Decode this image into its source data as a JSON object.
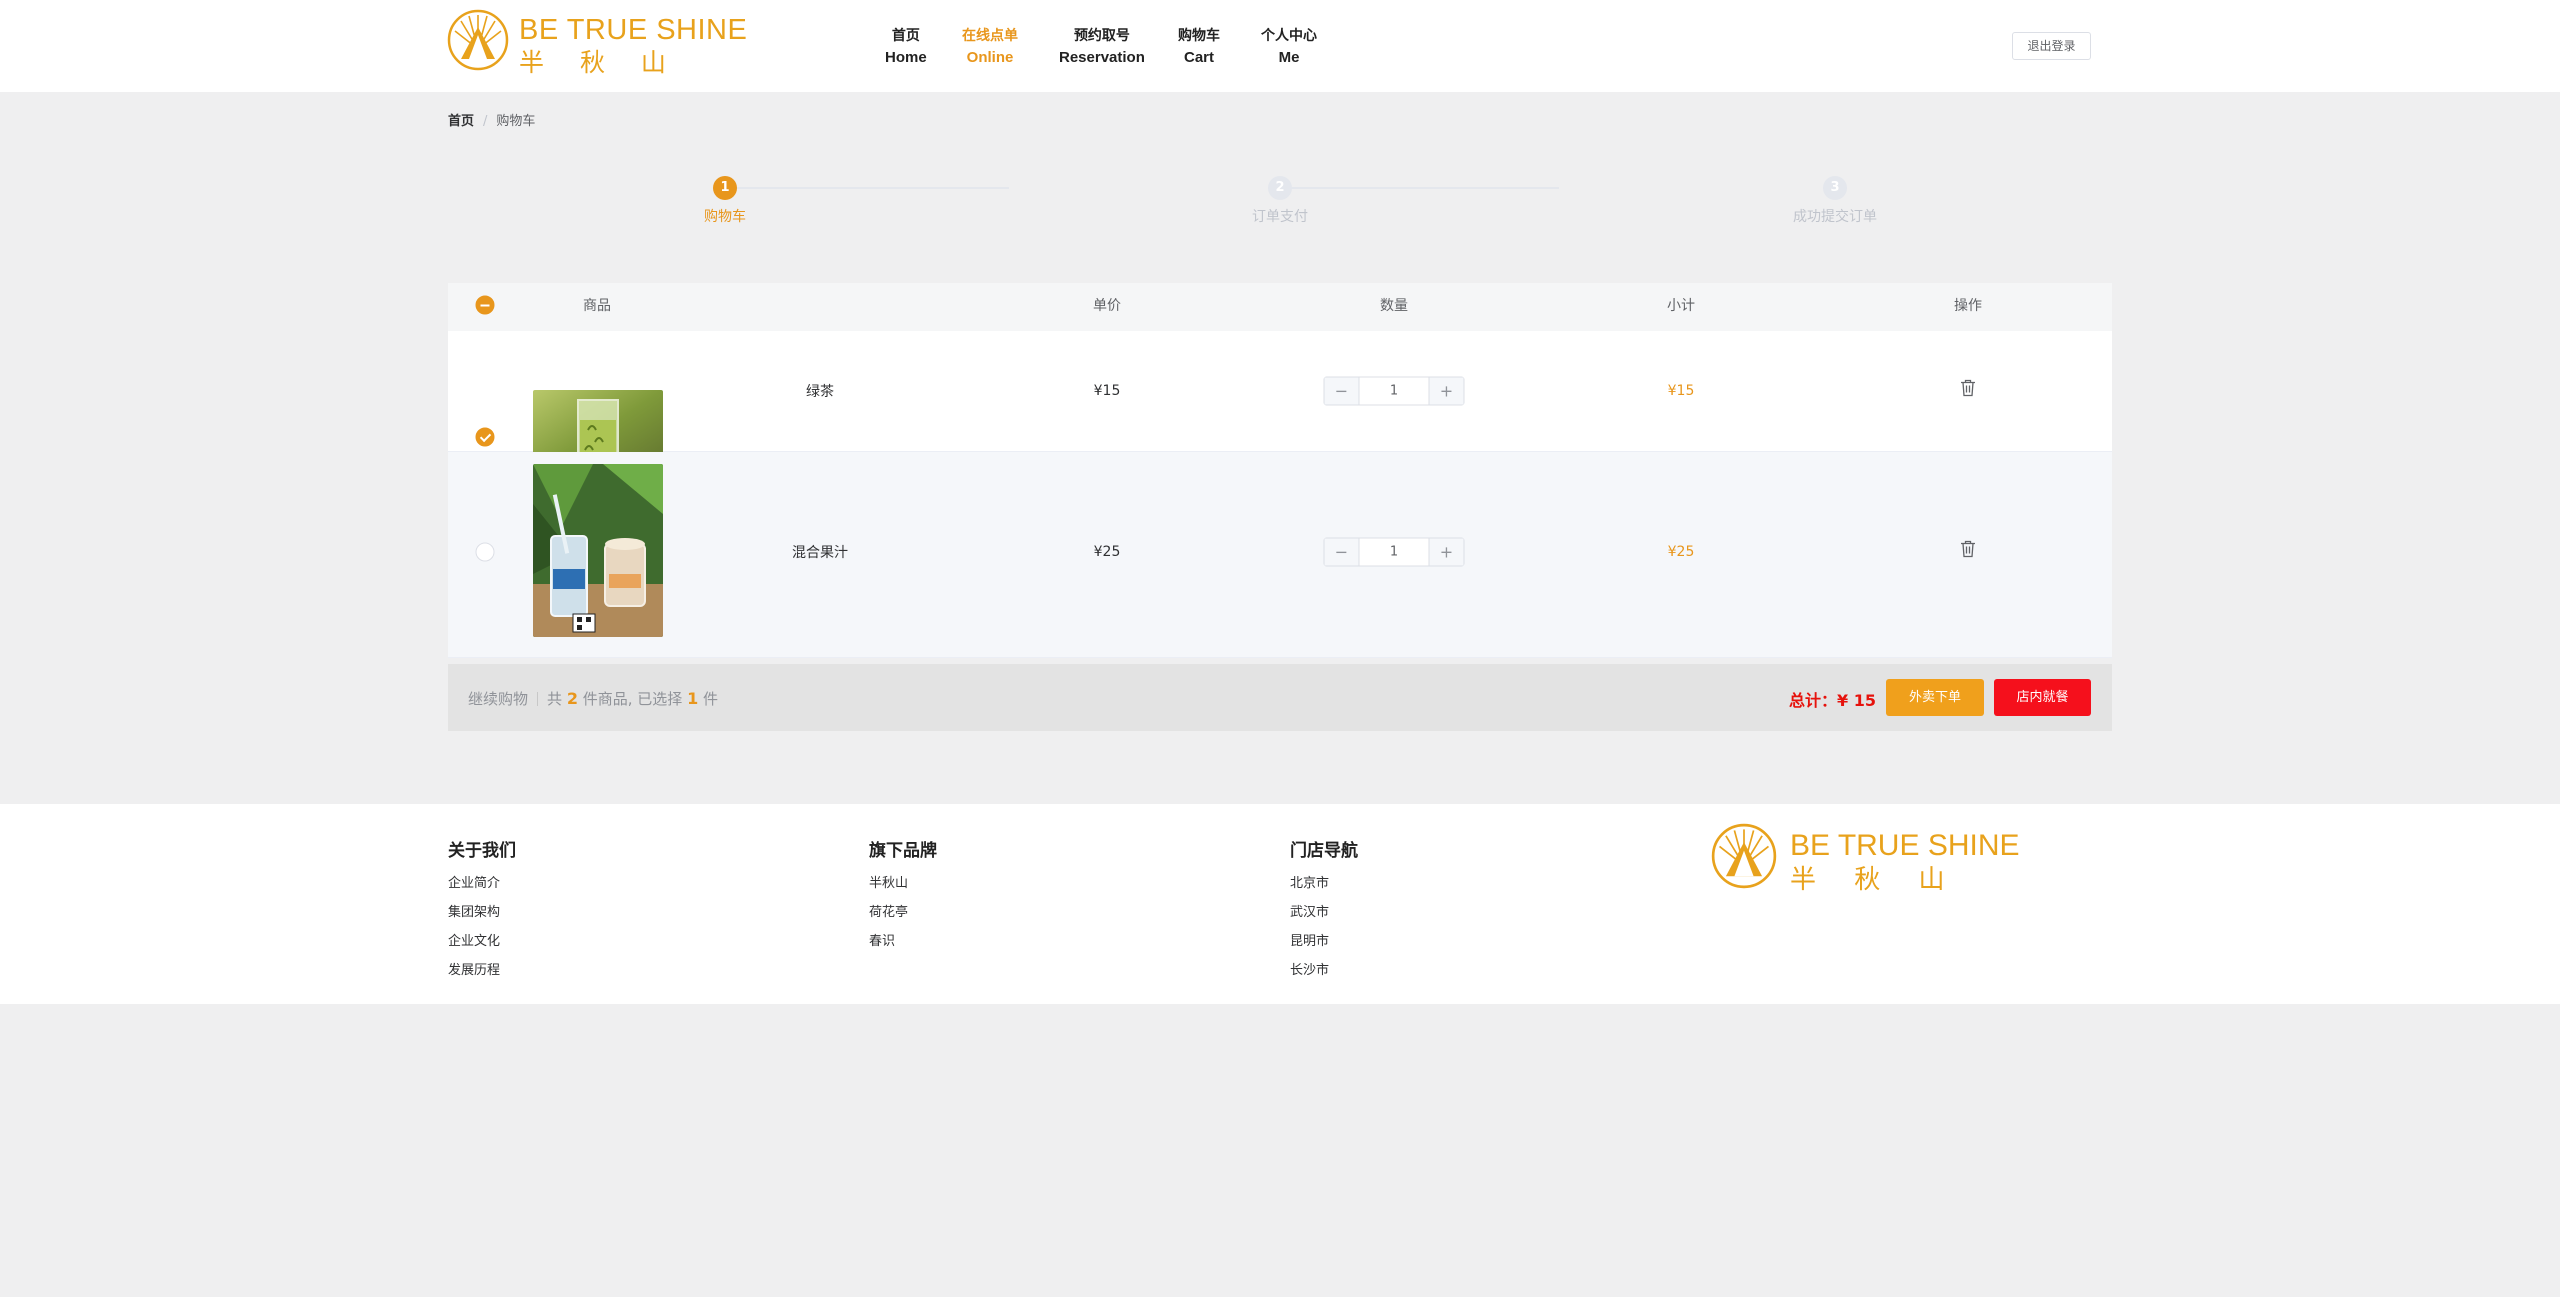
{
  "header": {
    "logo": {
      "en": "BE TRUE SHINE",
      "cn": "半 秋 山"
    },
    "nav": [
      {
        "cn": "首页",
        "en": "Home"
      },
      {
        "cn": "在线点单",
        "en": "Online",
        "active": true
      },
      {
        "cn": "预约取号",
        "en": "Reservation"
      },
      {
        "cn": "购物车",
        "en": "Cart"
      },
      {
        "cn": "个人中心",
        "en": "Me"
      }
    ],
    "logout_label": "退出登录"
  },
  "breadcrumb": {
    "home": "首页",
    "separator": "/",
    "current": "购物车"
  },
  "steps": [
    {
      "num": "1",
      "label": "购物车",
      "active": true
    },
    {
      "num": "2",
      "label": "订单支付",
      "active": false
    },
    {
      "num": "3",
      "label": "成功提交订单",
      "active": false
    }
  ],
  "table": {
    "headers": {
      "product": "商品",
      "unit_price": "单价",
      "quantity": "数量",
      "subtotal": "小计",
      "action": "操作"
    },
    "rows": [
      {
        "checked": true,
        "name": "绿茶",
        "price": "¥15",
        "qty": "1",
        "subtotal": "¥15",
        "image": "green-tea-photo"
      },
      {
        "checked": false,
        "name": "混合果汁",
        "price": "¥25",
        "qty": "1",
        "subtotal": "¥25",
        "image": "mixed-juice-photo"
      }
    ],
    "stepper": {
      "minus": "−",
      "plus": "+"
    }
  },
  "summary": {
    "continue_label": "继续购物",
    "prefix": "共",
    "total_count": "2",
    "mid": "件商品, 已选择",
    "selected_count": "1",
    "suffix": "件",
    "total_label": "总计：",
    "total_value": "¥ 15",
    "takeout_label": "外卖下单",
    "dinein_label": "店内就餐"
  },
  "footer": {
    "columns": [
      {
        "title": "关于我们",
        "links": [
          "企业简介",
          "集团架构",
          "企业文化",
          "发展历程"
        ]
      },
      {
        "title": "旗下品牌",
        "links": [
          "半秋山",
          "荷花亭",
          "春识"
        ]
      },
      {
        "title": "门店导航",
        "links": [
          "北京市",
          "武汉市",
          "昆明市",
          "长沙市"
        ]
      }
    ],
    "logo": {
      "en": "BE TRUE SHINE",
      "cn": "半 秋 山"
    }
  },
  "colors": {
    "accent": "#e8961c",
    "danger": "#f5101c",
    "brand": "#e8a21c"
  }
}
